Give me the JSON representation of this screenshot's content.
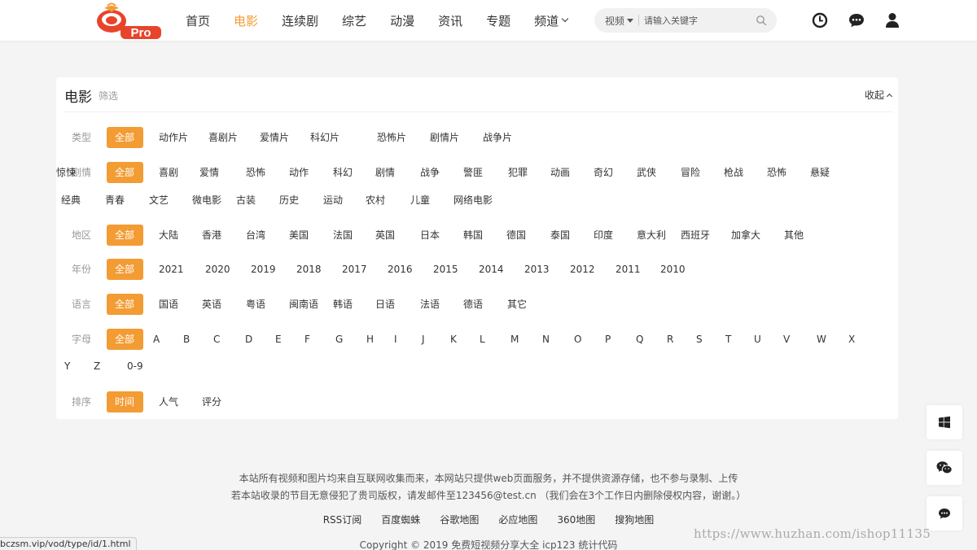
{
  "logo": {
    "badge": "Pro"
  },
  "nav": {
    "items": [
      {
        "label": "首页",
        "active": false
      },
      {
        "label": "电影",
        "active": true
      },
      {
        "label": "连续剧",
        "active": false
      },
      {
        "label": "综艺",
        "active": false
      },
      {
        "label": "动漫",
        "active": false
      },
      {
        "label": "资讯",
        "active": false
      },
      {
        "label": "专题",
        "active": false
      },
      {
        "label": "频道",
        "active": false,
        "has_dropdown": true
      }
    ]
  },
  "search": {
    "type": "视频",
    "placeholder": "请输入关键字"
  },
  "header_icons": [
    "clock-icon",
    "chat-bubble-icon",
    "user-icon"
  ],
  "filter": {
    "title": "电影",
    "subtitle": "筛选",
    "collapse_label": "收起",
    "rows": [
      {
        "label": "类型",
        "options": [
          "全部",
          "动作片",
          "喜剧片",
          "爱情片",
          "科幻片",
          "恐怖片",
          "剧情片",
          "战争片"
        ]
      },
      {
        "label": "剧情",
        "options": [
          "全部",
          "喜剧",
          "爱情",
          "恐怖",
          "动作",
          "科幻",
          "剧情",
          "战争",
          "警匪",
          "犯罪",
          "动画",
          "奇幻",
          "武侠",
          "冒险",
          "枪战",
          "恐怖",
          "悬疑",
          "惊悚",
          "经典",
          "青春",
          "文艺",
          "微电影",
          "古装",
          "历史",
          "运动",
          "农村",
          "儿童",
          "网络电影"
        ]
      },
      {
        "label": "地区",
        "options": [
          "全部",
          "大陆",
          "香港",
          "台湾",
          "美国",
          "法国",
          "英国",
          "日本",
          "韩国",
          "德国",
          "泰国",
          "印度",
          "意大利",
          "西班牙",
          "加拿大",
          "其他"
        ]
      },
      {
        "label": "年份",
        "options": [
          "全部",
          "2021",
          "2020",
          "2019",
          "2018",
          "2017",
          "2016",
          "2015",
          "2014",
          "2013",
          "2012",
          "2011",
          "2010"
        ]
      },
      {
        "label": "语言",
        "options": [
          "全部",
          "国语",
          "英语",
          "粤语",
          "闽南语",
          "韩语",
          "日语",
          "法语",
          "德语",
          "其它"
        ]
      },
      {
        "label": "字母",
        "options": [
          "全部",
          "A",
          "B",
          "C",
          "D",
          "E",
          "F",
          "G",
          "H",
          "I",
          "J",
          "K",
          "L",
          "M",
          "N",
          "O",
          "P",
          "Q",
          "R",
          "S",
          "T",
          "U",
          "V",
          "W",
          "X",
          "Y",
          "Z",
          "0-9"
        ]
      },
      {
        "label": "排序",
        "options": [
          "时间",
          "人气",
          "评分"
        ]
      }
    ]
  },
  "side_buttons": [
    "windows-icon",
    "wechat-icon",
    "message-icon"
  ],
  "footer": {
    "line1": "本站所有视频和图片均来自互联网收集而来，本网站只提供web页面服务，并不提供资源存储，也不参与录制、上传",
    "line2": "若本站收录的节目无意侵犯了贵司版权，请发邮件至123456@test.cn （我们会在3个工作日内删除侵权内容，谢谢。）",
    "links": [
      "RSS订阅",
      "百度蜘蛛",
      "谷歌地图",
      "必应地图",
      "360地图",
      "搜狗地图"
    ],
    "copyright": "Copyright © 2019 免费短视频分享大全 icp123 统计代码"
  },
  "status_url": "bczsm.vip/vod/type/id/1.html",
  "watermark": "https://www.huzhan.com/ishop11135",
  "colors": {
    "accent": "#f39c34",
    "logo_red": "#e8442c"
  }
}
